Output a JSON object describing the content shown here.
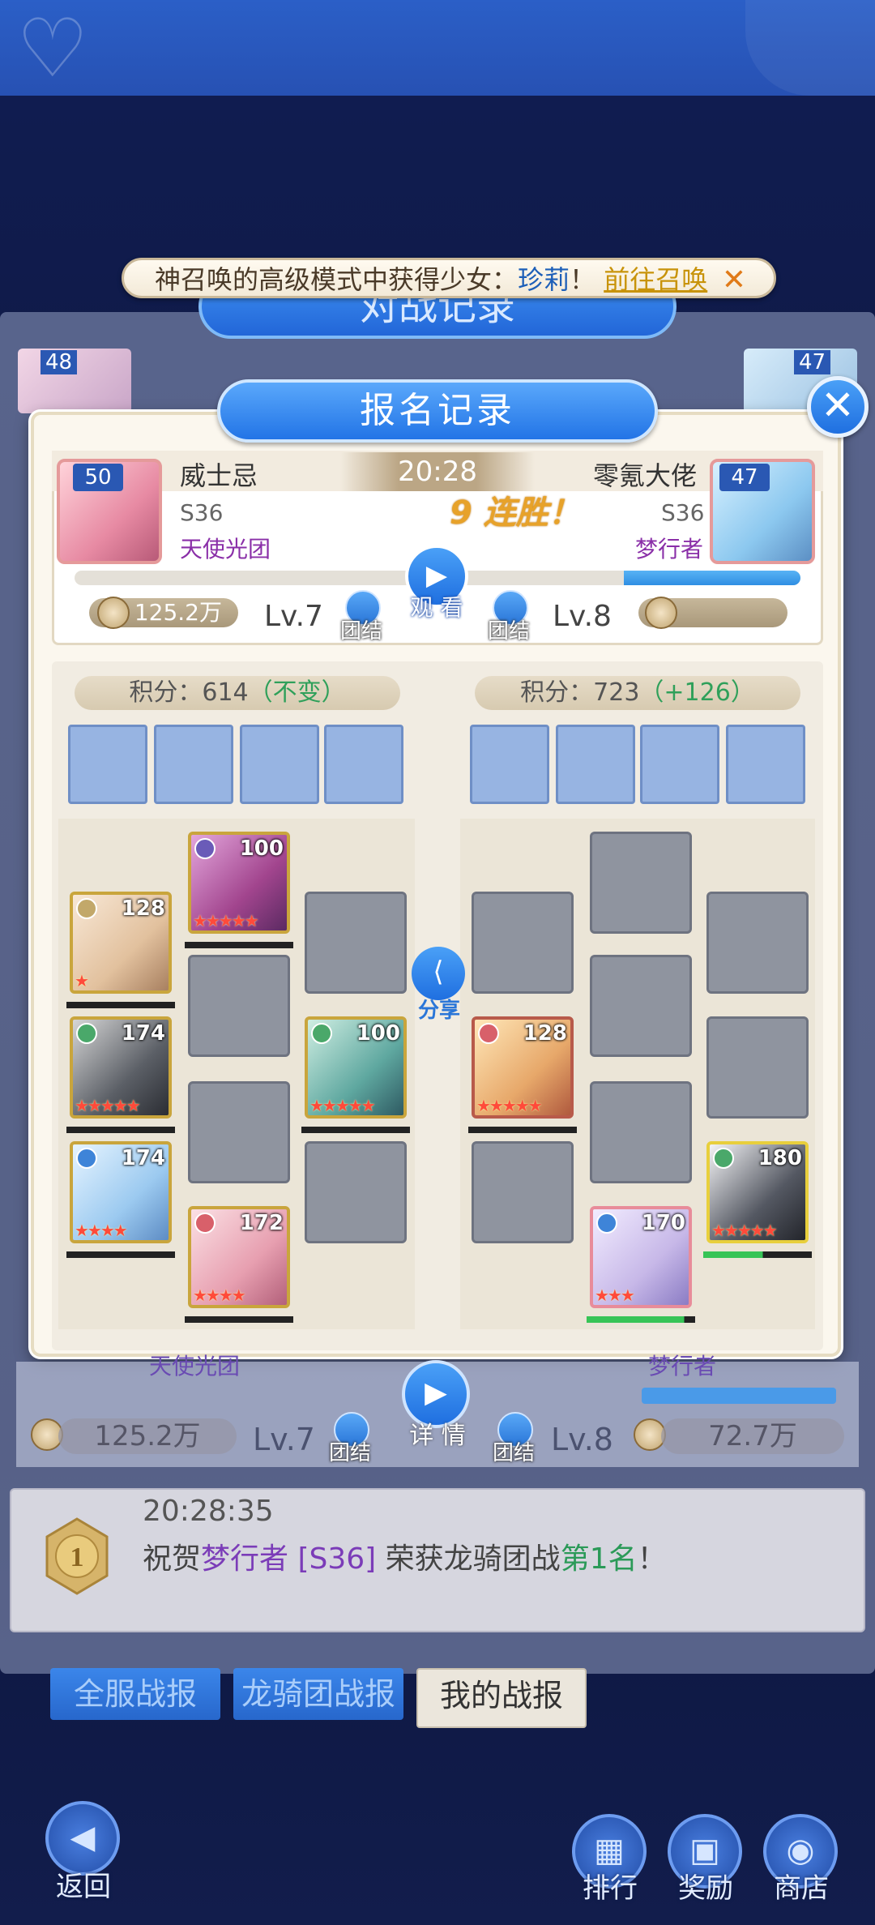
{
  "notice": {
    "text_prefix": "神召唤的高级模式中获得少女：",
    "hero_name": "珍莉",
    "exclaim": "！",
    "link": "前往召唤",
    "close": "✕"
  },
  "background": {
    "title": "对战记录",
    "row1_left_level": "48",
    "row1_right_level": "47",
    "row1_left_server": "S36",
    "row1_right_server": "S36",
    "lower_left_guild": "天使光团",
    "lower_right_guild": "梦行者",
    "lower_left_power": "125.2万",
    "lower_right_power": "72.7万",
    "lower_left_lv": "Lv.7",
    "lower_right_lv": "Lv.8",
    "unity_label": "团结",
    "detail_label": "详 情"
  },
  "dialog": {
    "title": "报名记录",
    "close": "✕",
    "time": "20:28",
    "streak": "9 连胜！",
    "watch_label": "观 看",
    "left": {
      "level": "50",
      "name": "威士忌",
      "server": "S36",
      "guild": "天使光团",
      "power": "125.2万",
      "lv": "Lv.7",
      "unity": "团结",
      "score_label": "积分：614",
      "score_change": "（不变）"
    },
    "right": {
      "level": "47",
      "name": "零氪大佬",
      "server": "S36",
      "guild": "梦行者",
      "power": "",
      "lv": "Lv.8",
      "unity": "团结",
      "score_label": "积分：723",
      "score_change": "（+126）"
    },
    "share_label": "分享",
    "left_heroes": [
      {
        "power": "100",
        "stars": "★★★★★"
      },
      {
        "power": "128",
        "stars": "★"
      },
      {
        "power": "174",
        "stars": "★★★★★"
      },
      {
        "power": "100",
        "stars": "★★★★★"
      },
      {
        "power": "174",
        "stars": "★★★★"
      },
      {
        "power": "172",
        "stars": "★★★★"
      }
    ],
    "right_heroes": [
      {
        "power": "128",
        "stars": "★★★★★"
      },
      {
        "power": "180",
        "stars": "★★★★★",
        "hp": 0.55
      },
      {
        "power": "170",
        "stars": "★★★",
        "hp": 0.9
      }
    ]
  },
  "news": {
    "time": "20:28:35",
    "t1": "祝贺",
    "guild": "梦行者",
    "t2": " [S36] ",
    "t3": "荣获龙骑团战",
    "rank": "第1名",
    "t4": "！"
  },
  "tabs": [
    "全服战报",
    "龙骑团战报",
    "我的战报"
  ],
  "bottom": {
    "back": "返回",
    "rank": "排行",
    "reward": "奖励",
    "shop": "商店"
  },
  "colors": {
    "accent_blue": "#2274e6",
    "streak_gold": "#e7a22a",
    "guild_purple": "#8a2fa8",
    "positive_green": "#2fa05a"
  }
}
